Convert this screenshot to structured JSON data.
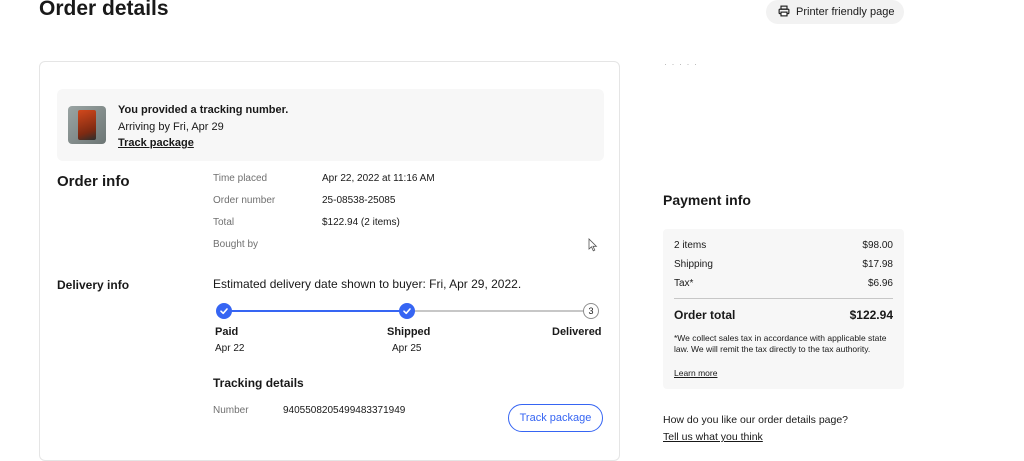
{
  "header": {
    "title": "Order details",
    "printer_label": "Printer friendly page",
    "printer_icon": "printer-icon"
  },
  "top_right_faint": "· · · · ·",
  "banner": {
    "title": "You provided a tracking number.",
    "arriving": "Arriving by Fri, Apr 29",
    "link": "Track package"
  },
  "order_info": {
    "heading": "Order info",
    "rows": [
      {
        "label": "Time placed",
        "value": "Apr 22, 2022 at 11:16 AM"
      },
      {
        "label": "Order number",
        "value": "25-08538-25085"
      },
      {
        "label": "Total",
        "value": "$122.94 (2 items)"
      },
      {
        "label": "Bought by",
        "value": ""
      }
    ]
  },
  "delivery_info": {
    "heading": "Delivery info",
    "estimate": "Estimated delivery date shown to buyer: Fri, Apr 29, 2022.",
    "steps": [
      {
        "label": "Paid",
        "date": "Apr 22",
        "done": true
      },
      {
        "label": "Shipped",
        "date": "Apr 25",
        "done": true
      },
      {
        "label": "Delivered",
        "date": "",
        "done": false,
        "number": "3"
      }
    ]
  },
  "tracking": {
    "heading": "Tracking details",
    "number_label": "Number",
    "number_value": "9405508205499483371949",
    "button": "Track package"
  },
  "payment": {
    "heading": "Payment info",
    "rows": [
      {
        "label": "2 items",
        "value": "$98.00"
      },
      {
        "label": "Shipping",
        "value": "$17.98"
      },
      {
        "label": "Tax*",
        "value": "$6.96"
      }
    ],
    "total_label": "Order total",
    "total_value": "$122.94",
    "note": "*We collect sales tax in accordance with applicable state law. We will remit the tax directly to the tax authority.",
    "learn_more": "Learn more"
  },
  "feedback": {
    "question": "How do you like our order details page?",
    "link": "Tell us what you think"
  },
  "colors": {
    "accent": "#3665f3",
    "text": "#191919",
    "muted": "#707070",
    "panel": "#f7f7f7"
  }
}
